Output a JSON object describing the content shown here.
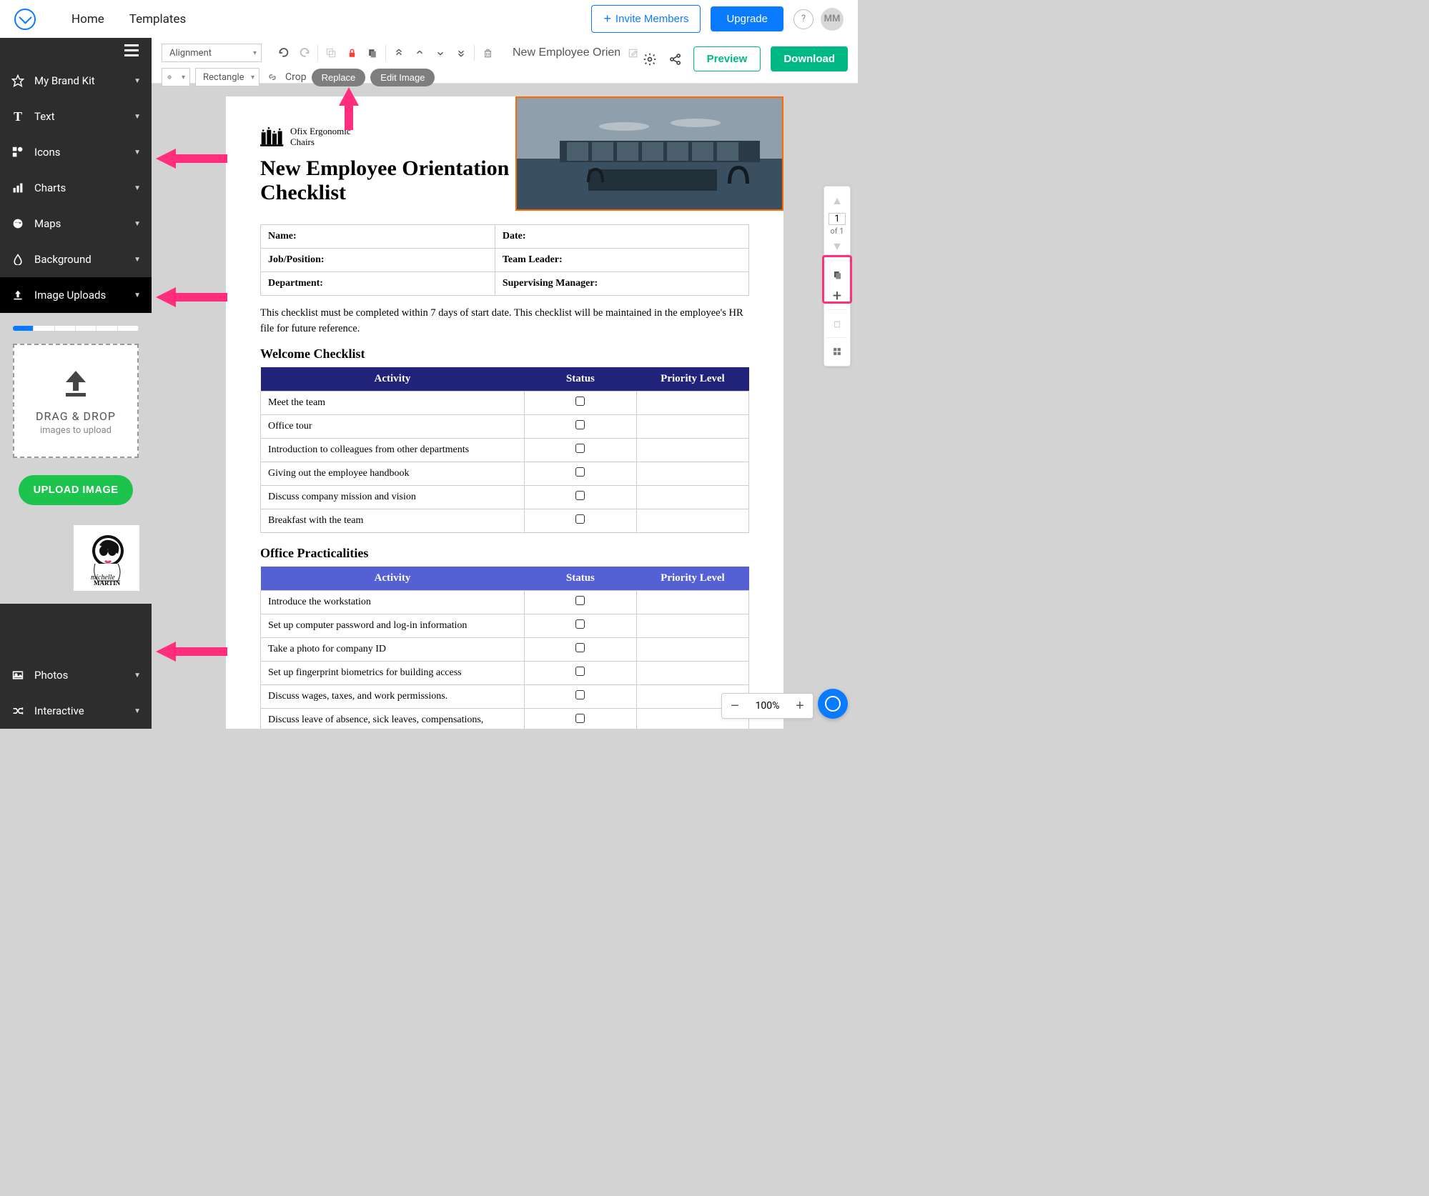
{
  "header": {
    "home": "Home",
    "templates": "Templates",
    "invite": "Invite Members",
    "upgrade": "Upgrade",
    "help": "?",
    "avatar": "MM"
  },
  "sidebar": {
    "items": [
      {
        "label": "My Brand Kit"
      },
      {
        "label": "Text"
      },
      {
        "label": "Icons"
      },
      {
        "label": "Charts"
      },
      {
        "label": "Maps"
      },
      {
        "label": "Background"
      },
      {
        "label": "Image Uploads"
      }
    ],
    "dropzone_title": "DRAG & DROP",
    "dropzone_sub": "images to upload",
    "upload_btn": "UPLOAD IMAGE",
    "bottom": [
      {
        "label": "Photos"
      },
      {
        "label": "Interactive"
      }
    ]
  },
  "toolbar": {
    "alignment": "Alignment",
    "shape": "Rectangle",
    "crop": "Crop",
    "replace": "Replace",
    "edit_image": "Edit Image",
    "title": "New Employee Orient...",
    "preview": "Preview",
    "download": "Download"
  },
  "doc": {
    "brand_line1": "Ofix Ergonomic",
    "brand_line2": "Chairs",
    "title": "New Employee Orientation Checklist",
    "info": {
      "name": "Name:",
      "date": "Date:",
      "job": "Job/Position:",
      "team_leader": "Team Leader:",
      "dept": "Department:",
      "supervisor": "Supervising Manager:"
    },
    "intro": "This checklist must be completed within 7 days of start date. This checklist will be maintained in the employee's HR file for future reference.",
    "section1_title": "Welcome Checklist",
    "section2_title": "Office Practicalities",
    "columns": {
      "activity": "Activity",
      "status": "Status",
      "priority": "Priority Level"
    },
    "section1_rows": [
      "Meet the team",
      "Office tour",
      "Introduction to colleagues from other departments",
      "Giving out the employee handbook",
      "Discuss company mission and vision",
      "Breakfast with the team"
    ],
    "section2_rows": [
      "Introduce the workstation",
      "Set up computer password and log-in information",
      "Take a photo for company ID",
      "Set up fingerprint biometrics for building access",
      "Discuss wages, taxes, and work permissions.",
      "Discuss leave of absence, sick leaves, compensations,"
    ]
  },
  "page_tools": {
    "current": "1",
    "total": "of 1"
  },
  "zoom": {
    "level": "100%"
  }
}
